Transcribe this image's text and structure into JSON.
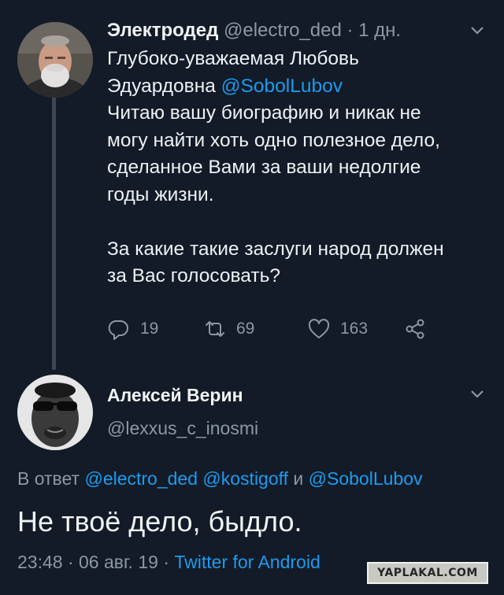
{
  "tweet": {
    "author_name": "Электродед",
    "author_handle": "@electro_ded",
    "time_ago": "· 1 дн.",
    "lines1": [
      "Глубоко-уважаемая Любовь",
      "Эдуардовна "
    ],
    "mention_sobol": "@SobolLubov",
    "lines2": [
      "Читаю вашу биографию и никак не",
      "могу найти хоть одно полезное дело,",
      "сделанное Вами за ваши недолгие",
      "годы жизни."
    ],
    "lines3": [
      "За какие такие заслуги народ должен",
      "за Вас голосовать?"
    ],
    "stats": {
      "replies": "19",
      "retweets": "69",
      "likes": "163"
    }
  },
  "reply": {
    "author_name": "Алексей Верин",
    "author_handle": "@lexxus_c_inosmi",
    "reply_prefix": "В ответ",
    "mention1": "@electro_ded",
    "mention2": "@kostigoff",
    "conj": "и",
    "mention3": "@SobolLubov",
    "text": "Не твоё дело, быдло.",
    "time": "23:48 · 06 авг. 19 ·",
    "source": "Twitter for Android"
  },
  "watermark": "YAPLAKAL.COM",
  "colors": {
    "background": "#121b27",
    "link": "#1d9bf0",
    "muted": "#8b98a5"
  },
  "icons": [
    "reply-icon",
    "retweet-icon",
    "like-icon",
    "share-icon",
    "chevron-down-icon"
  ]
}
